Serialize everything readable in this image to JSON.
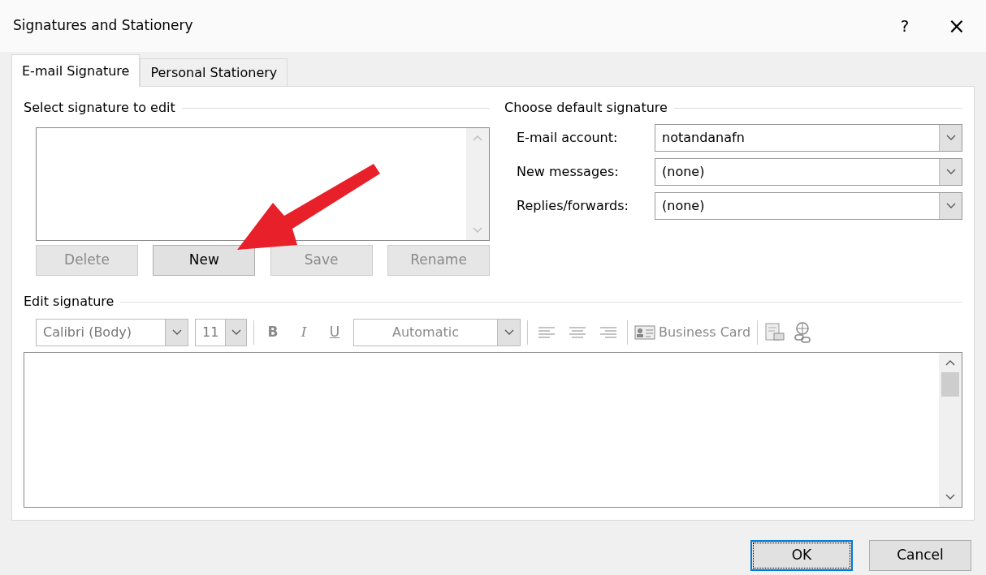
{
  "window": {
    "title": "Signatures and Stationery",
    "help": "?",
    "close": "×"
  },
  "tabs": [
    {
      "label": "E-mail Signature",
      "selected": true
    },
    {
      "label": "Personal Stationery",
      "selected": false
    }
  ],
  "select_signature": {
    "heading": "Select signature to edit",
    "buttons": [
      {
        "label": "Delete",
        "disabled": true
      },
      {
        "label": "New",
        "disabled": false
      },
      {
        "label": "Save",
        "disabled": true
      },
      {
        "label": "Rename",
        "disabled": true
      }
    ]
  },
  "default_signature": {
    "heading": "Choose default signature",
    "fields": [
      {
        "label": "E-mail account:",
        "value": "notandanafn"
      },
      {
        "label": "New messages:",
        "value": "(none)"
      },
      {
        "label": "Replies/forwards:",
        "value": "(none)"
      }
    ]
  },
  "edit_signature": {
    "heading": "Edit signature",
    "font": "Calibri (Body)",
    "size": "11",
    "bold": "B",
    "italic": "I",
    "underline": "U",
    "font_color": "Automatic",
    "business_card": "Business Card",
    "toolbar_disabled": true
  },
  "buttons": [
    {
      "label": "OK",
      "default": true
    },
    {
      "label": "Cancel",
      "default": false
    }
  ]
}
